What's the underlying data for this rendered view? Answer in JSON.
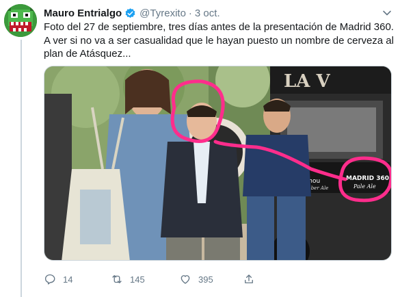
{
  "tweet": {
    "author_name": "Mauro Entrialgo",
    "handle": "@Tyrexito",
    "separator": "·",
    "date": "3 oct.",
    "text": "Foto del 27 de septiembre, tres días antes de la presentación de Madrid 360. A ver si no va a ser casualidad que le hayan puesto un nombre de cerveza al plan de Atásquez...",
    "media": {
      "truck_banner_text": "LA V",
      "truck_label_text": "MADRID 360",
      "truck_label_script": "Pale Ale",
      "truck_small_label": "Mahou",
      "truck_small_script": "Amber Ale"
    },
    "actions": {
      "replies": "14",
      "retweets": "145",
      "likes": "395"
    },
    "colors": {
      "annotation": "#ff2d8c",
      "verified": "#1da1f2",
      "muted": "#657786"
    }
  }
}
